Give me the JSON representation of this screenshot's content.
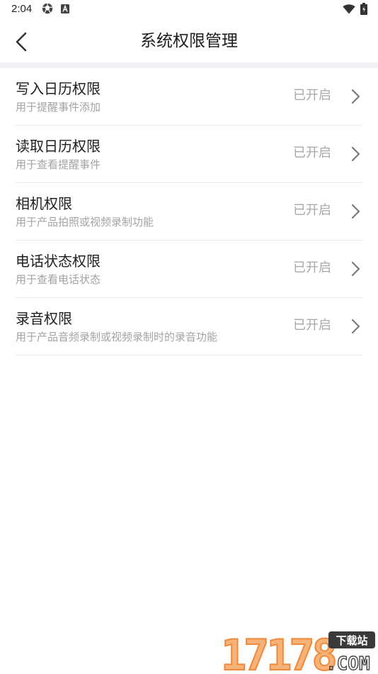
{
  "status_bar": {
    "time": "2:04",
    "left_icons": [
      "aperture-icon",
      "font-a-icon"
    ],
    "right_icons": [
      "wifi-icon",
      "battery-icon"
    ]
  },
  "header": {
    "title": "系统权限管理",
    "back_icon": "chevron-left-icon"
  },
  "permissions": [
    {
      "title": "写入日历权限",
      "desc": "用于提醒事件添加",
      "status": "已开启"
    },
    {
      "title": "读取日历权限",
      "desc": "用于查看提醒事件",
      "status": "已开启"
    },
    {
      "title": "相机权限",
      "desc": "用于产品拍照或视频录制功能",
      "status": "已开启"
    },
    {
      "title": "电话状态权限",
      "desc": "用于查看电话状态",
      "status": "已开启"
    },
    {
      "title": "录音权限",
      "desc": "用于产品音频录制或视频录制时的录音功能",
      "status": "已开启"
    }
  ],
  "watermark": {
    "number": "17178",
    "badge": "下载站",
    "suffix": ".COM"
  },
  "colors": {
    "divider": "#ececec",
    "header_gap": "#f1f1f5",
    "secondary_text": "#a3a3a3",
    "status_text": "#a8a8a8",
    "watermark_orange": "#f08a3a",
    "watermark_dark": "#3a3a3a"
  }
}
